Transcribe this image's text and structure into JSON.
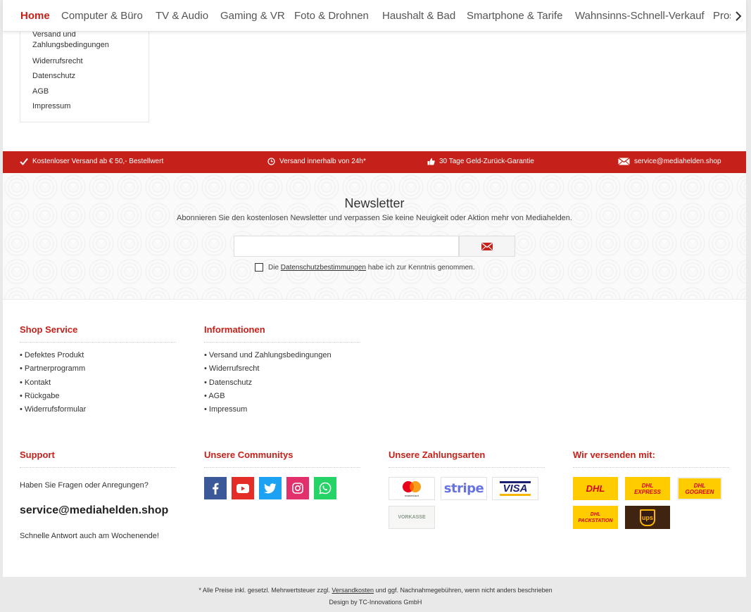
{
  "nav": {
    "items": [
      "Home",
      "Computer & Büro",
      "TV & Audio",
      "Gaming & VR",
      "Foto & Drohnen",
      "Haushalt & Bad",
      "Smartphone & Tarife",
      "Wahnsinns-Schnell-Verkauf",
      "Pros"
    ],
    "next_icon": "chevron-right-icon"
  },
  "side_menu": {
    "items": [
      "Versand und Zahlungsbedingungen",
      "Widerrufsrecht",
      "Datenschutz",
      "AGB",
      "Impressum"
    ]
  },
  "usp_bar": {
    "color": "#c5211a",
    "items": [
      {
        "icon": "check-icon",
        "text": "Kostenloser Versand ab € 50,- Bestellwert"
      },
      {
        "icon": "clock-icon",
        "text": "Versand innerhalb von 24h*"
      },
      {
        "icon": "thumbs-up-icon",
        "text": "30 Tage Geld-Zurück-Garantie"
      },
      {
        "icon": "envelope-icon",
        "text": "service@mediahelden.shop"
      }
    ]
  },
  "newsletter": {
    "title": "Newsletter",
    "subtitle": "Abonnieren Sie den kostenlosen Newsletter und verpassen Sie keine Neuigkeit oder Aktion mehr von Mediahelden.",
    "email_value": "",
    "send_icon": "envelope-icon",
    "consent_before": "Die",
    "consent_link": "Datenschutzbestimmungen",
    "consent_after": "habe ich zur Kenntnis genommen."
  },
  "footer": {
    "shop_service": {
      "title": "Shop Service",
      "links": [
        "Defektes Produkt",
        "Partnerprogramm",
        "Kontakt",
        "Rückgabe",
        "Widerrufsformular"
      ]
    },
    "informationen": {
      "title": "Informationen",
      "links": [
        "Versand und Zahlungsbedingungen",
        "Widerrufsrecht",
        "Datenschutz",
        "AGB",
        "Impressum"
      ]
    },
    "support": {
      "title": "Support",
      "question": "Haben Sie Fragen oder Anregungen?",
      "email": "service@mediahelden.shop",
      "note": "Schnelle Antwort auch am Wochenende!"
    },
    "communities": {
      "title": "Unsere Communitys",
      "items": [
        {
          "icon": "facebook-icon",
          "color": "#3b5998"
        },
        {
          "icon": "youtube-icon",
          "color": "#e52d27"
        },
        {
          "icon": "twitter-icon",
          "color": "#1da1f2"
        },
        {
          "icon": "instagram-icon",
          "color": "#e1306c"
        },
        {
          "icon": "whatsapp-icon",
          "color": "#25d366"
        }
      ]
    },
    "payments": {
      "title": "Unsere Zahlungsarten",
      "items": [
        "mastercard",
        "stripe",
        "VISA",
        "VORKASSE"
      ]
    },
    "shipping": {
      "title": "Wir versenden mit:",
      "items": [
        "DHL",
        "DHL EXPRESS",
        "DHL GOGREEN",
        "DHL PACKSTATION",
        "ups"
      ]
    }
  },
  "bottom": {
    "prices_before": "* Alle Preise inkl. gesetzl. Mehrwertsteuer zzgl.",
    "prices_link": "Versandkosten",
    "prices_after": "und ggf. Nachnahmegebühren, wenn nicht anders beschrieben",
    "design": "Design by TC-Innovations GmbH"
  }
}
